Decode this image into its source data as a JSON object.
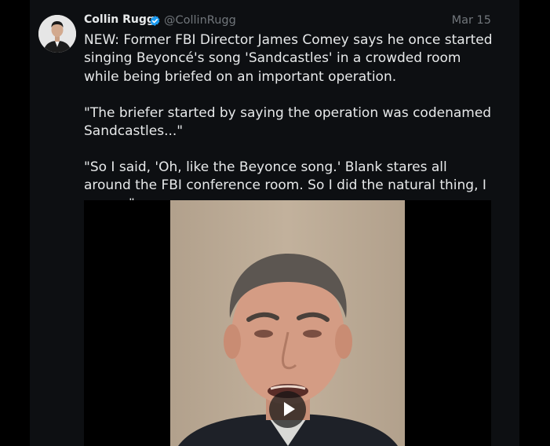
{
  "tweet": {
    "author_name": "Collin Rugg",
    "handle": "@CollinRugg",
    "date": "Mar 15",
    "paragraphs": [
      "NEW: Former FBI Director James Comey says he once started singing Beyoncé's song 'Sandcastles' in a crowded room while being briefed on an important operation.",
      "\"The briefer started by saying the operation was codenamed Sandcastles...\"",
      "\"So I said, 'Oh, like the Beyonce song.' Blank stares all around the FBI conference room. So I did the natural thing, I sang...\""
    ]
  },
  "icons": {
    "verified": "verified-badge-icon",
    "play": "play-icon"
  },
  "colors": {
    "background": "#000000",
    "panel": "#0d0f12",
    "text": "#e7e9ea",
    "muted": "#71767b",
    "verified": "#1d9bf0"
  }
}
